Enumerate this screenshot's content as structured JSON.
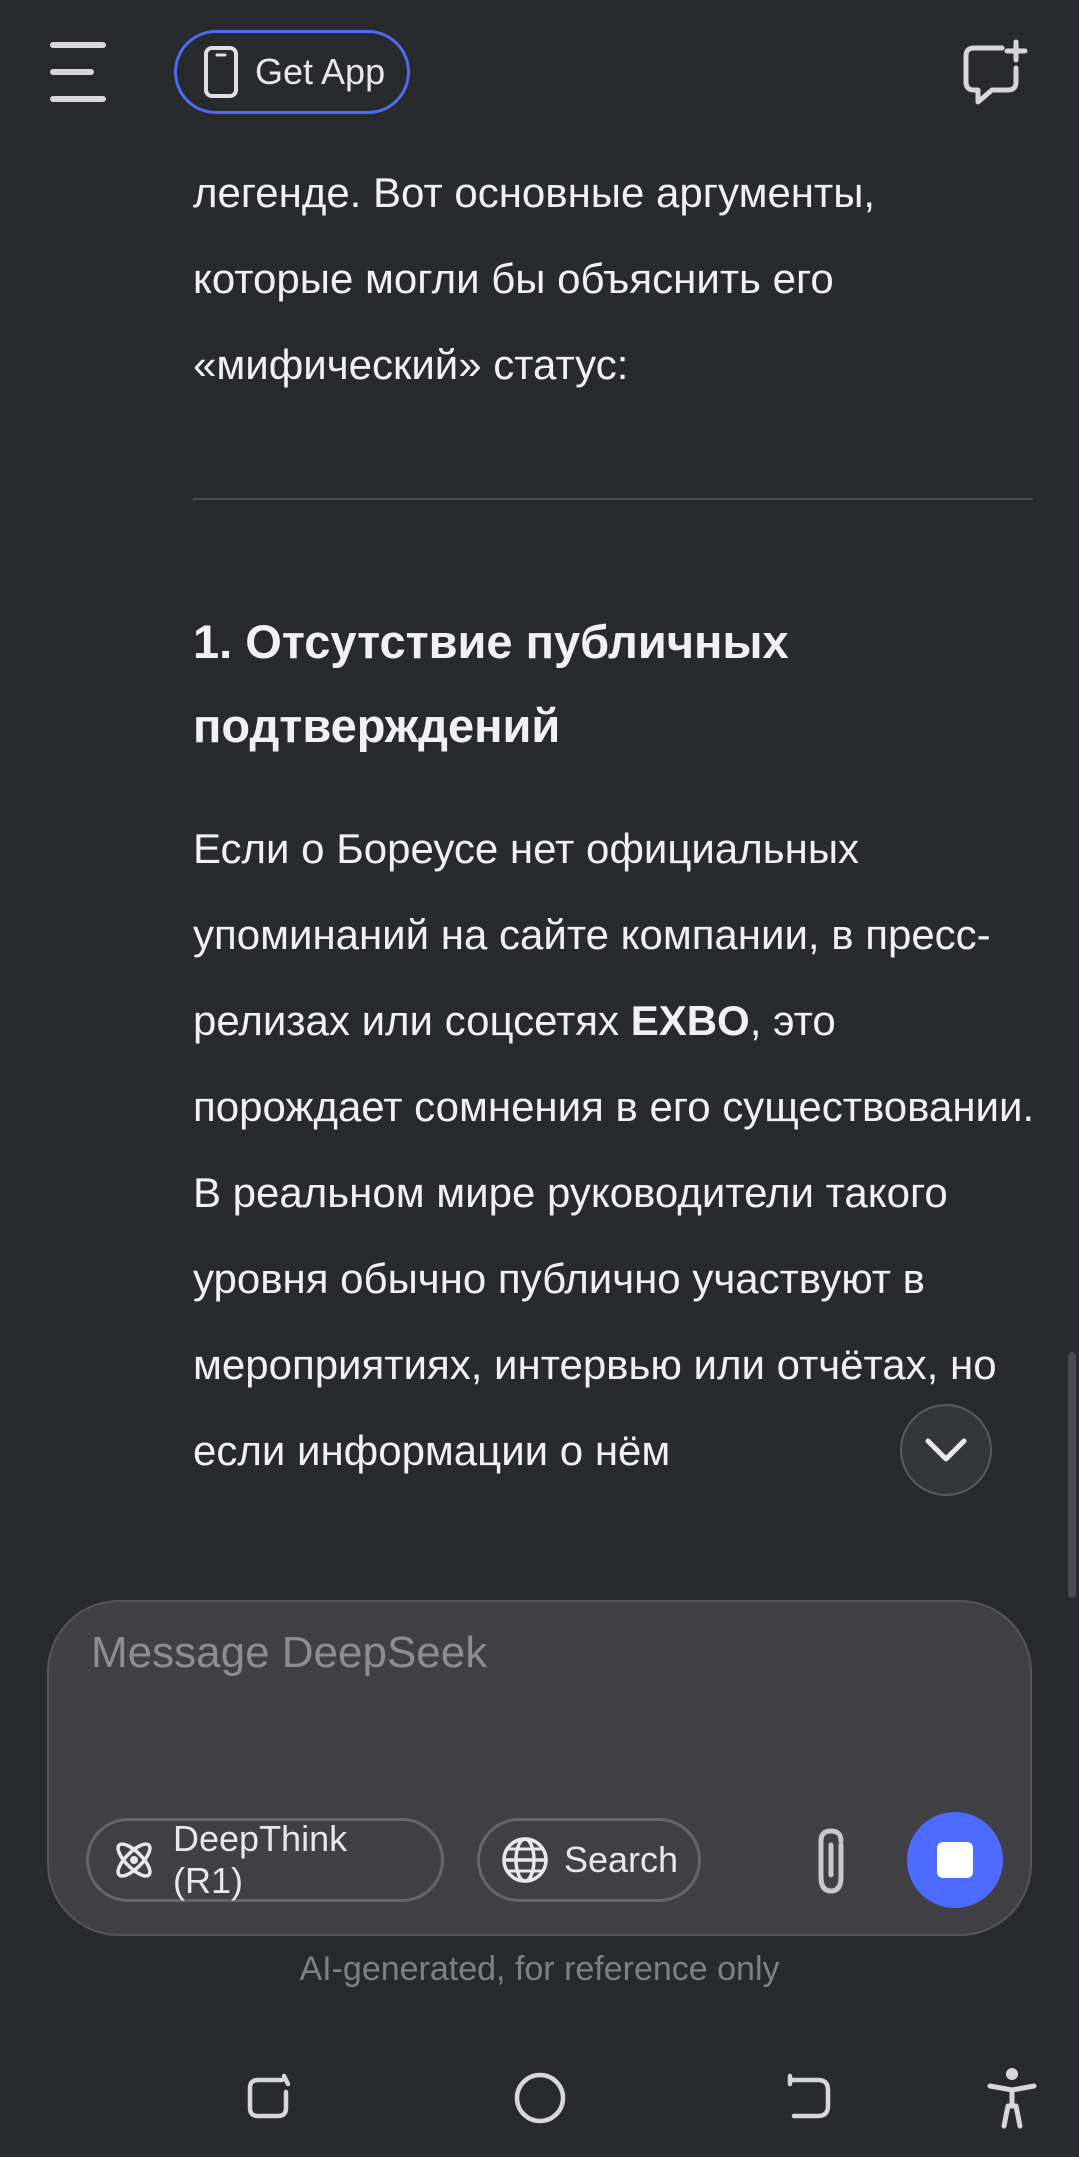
{
  "header": {
    "get_app_label": "Get App"
  },
  "content": {
    "intro": "легенде. Вот основные аргументы, которые могли бы объяснить его «мифический» статус:",
    "section_title": "1. Отсутствие публичных подтверждений",
    "paragraph_part1": "Если о Бореусе нет официальных упоминаний на сайте компании, в пресс-релизах или соцсетях ",
    "paragraph_bold": "EXBO",
    "paragraph_part2": ", это порождает сомнения в его существовании. В реальном мире руководители такого уровня обычно публично участвуют в мероприятиях, интервью или отчётах, но если информации о нём"
  },
  "composer": {
    "placeholder": "Message DeepSeek",
    "deepthink_label": "DeepThink (R1)",
    "search_label": "Search"
  },
  "footer": {
    "disclaimer": "AI-generated, for reference only"
  },
  "colors": {
    "background": "#292a2d",
    "accent": "#4d6bfe",
    "get_app_border": "#4f6bf0",
    "composer_bg": "#404045"
  },
  "icons": {
    "menu": "hamburger-menu-icon",
    "phone": "phone-icon",
    "new_chat": "new-chat-icon",
    "chevron": "chevron-down-icon",
    "deepthink": "atom-icon",
    "search": "globe-icon",
    "attach": "paperclip-icon",
    "stop": "stop-icon",
    "recents": "recents-icon",
    "home": "home-icon",
    "back": "back-icon",
    "accessibility": "accessibility-icon"
  }
}
